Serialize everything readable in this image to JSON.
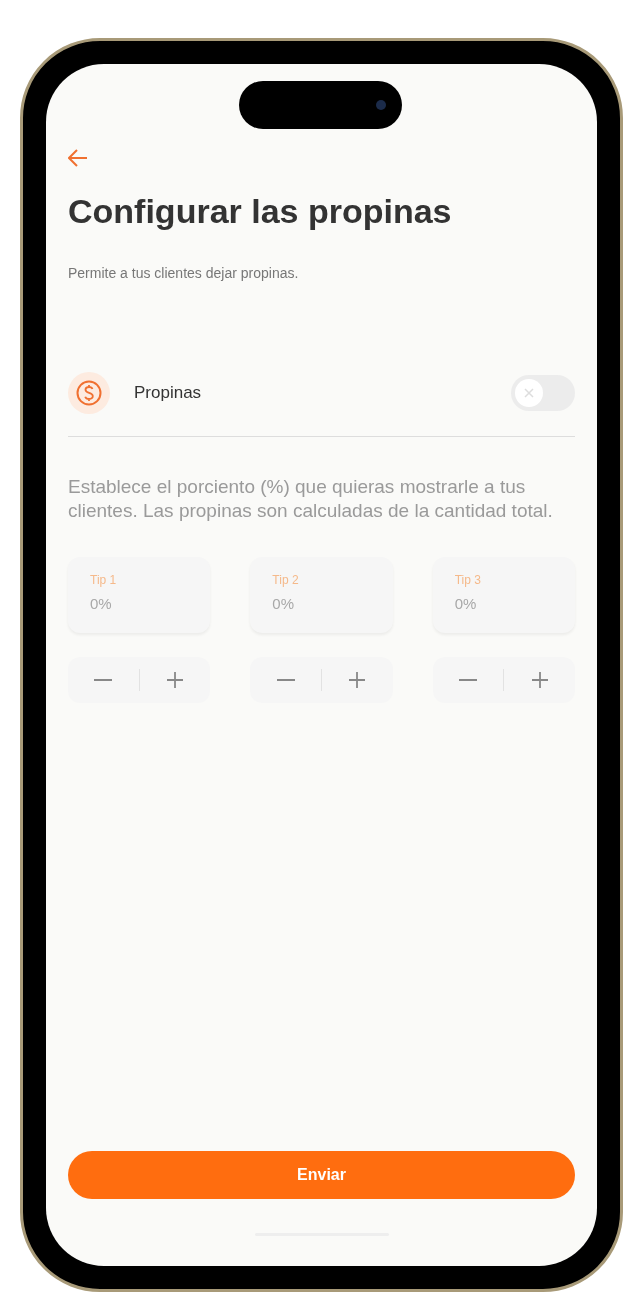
{
  "header": {
    "title": "Configurar las propinas",
    "subtitle": "Permite a tus clientes dejar propinas."
  },
  "tips_setting": {
    "label": "Propinas",
    "on": false
  },
  "description": "Establece el porciento (%) que quieras mostrarle a tus clientes. Las propinas son calculadas de la cantidad total.",
  "tips": [
    {
      "label": "Tip 1",
      "placeholder": "0%"
    },
    {
      "label": "Tip 2",
      "placeholder": "0%"
    },
    {
      "label": "Tip 3",
      "placeholder": "0%"
    }
  ],
  "submit_button": "Enviar"
}
